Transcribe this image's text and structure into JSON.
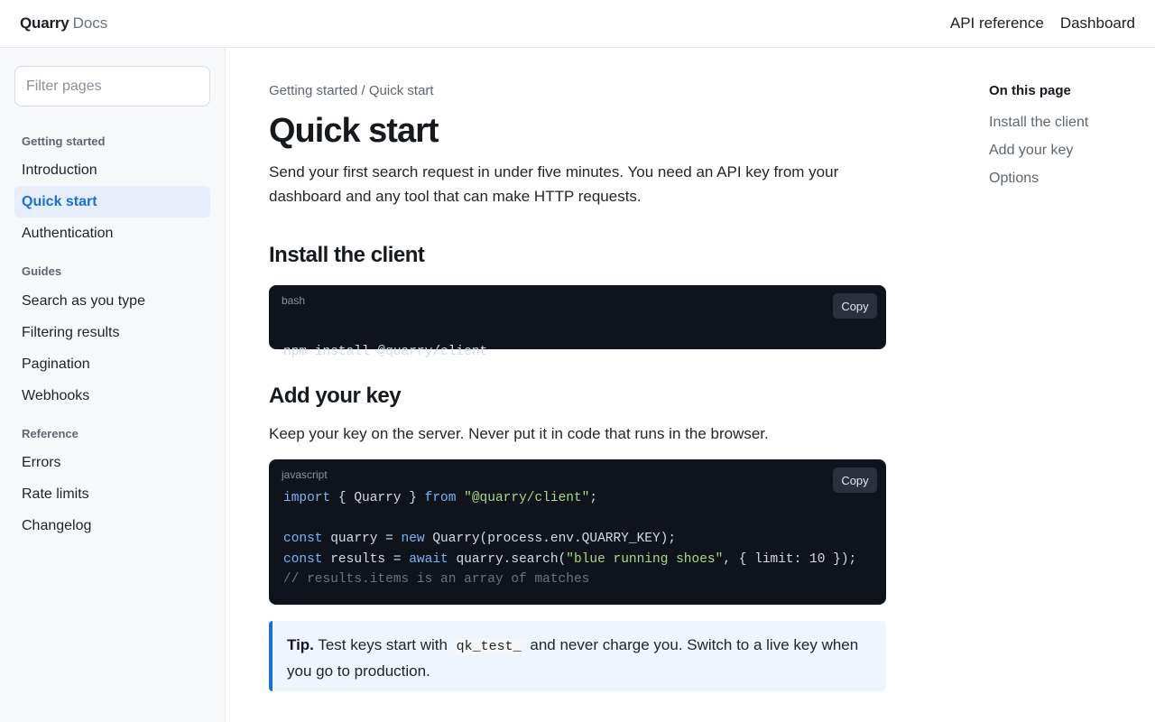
{
  "header": {
    "brand_name": "Quarry",
    "brand_suffix": "Docs",
    "nav": [
      "API reference",
      "Dashboard"
    ]
  },
  "sidebar": {
    "filter_placeholder": "Filter pages",
    "sections": [
      {
        "title": "Getting started",
        "items": [
          "Introduction",
          "Quick start",
          "Authentication"
        ]
      },
      {
        "title": "Guides",
        "items": [
          "Search as you type",
          "Filtering results",
          "Pagination",
          "Webhooks"
        ]
      },
      {
        "title": "Reference",
        "items": [
          "Errors",
          "Rate limits",
          "Changelog"
        ]
      }
    ],
    "active_item": "Quick start"
  },
  "main": {
    "breadcrumb": "Getting started / Quick start",
    "title": "Quick start",
    "intro": "Send your first search request in under five minutes. You need an API key from your dashboard and any tool that can make HTTP requests.",
    "install": {
      "heading": "Install the client",
      "code_lang": "bash",
      "copy_label": "Copy",
      "code": "npm install @quarry/client"
    },
    "key": {
      "heading": "Add your key",
      "text": "Keep your key on the server. Never put it in code that runs in the browser.",
      "code_lang": "javascript",
      "copy_label": "Copy",
      "code_lines": [
        [
          {
            "t": "import",
            "c": "kw"
          },
          {
            "t": " { Quarry } "
          },
          {
            "t": "from",
            "c": "kw"
          },
          {
            "t": " "
          },
          {
            "t": "\"@quarry/client\"",
            "c": "str"
          },
          {
            "t": ";"
          }
        ],
        [],
        [
          {
            "t": "const",
            "c": "kw"
          },
          {
            "t": " quarry = "
          },
          {
            "t": "new",
            "c": "kw"
          },
          {
            "t": " Quarry(process.env.QUARRY_KEY);"
          }
        ],
        [
          {
            "t": "const",
            "c": "kw"
          },
          {
            "t": " results = "
          },
          {
            "t": "await",
            "c": "kw"
          },
          {
            "t": " quarry.search("
          },
          {
            "t": "\"blue running shoes\"",
            "c": "str"
          },
          {
            "t": ", { limit: 10 });"
          }
        ],
        [
          {
            "t": "// results.items is an array of matches",
            "c": "cm"
          }
        ]
      ]
    },
    "tip": {
      "label": "Tip.",
      "before": " Test keys start with ",
      "code": "qk_test_",
      "after": " and never charge you. Switch to a live key when you go to production."
    }
  },
  "toc": {
    "title": "On this page",
    "items": [
      "Install the client",
      "Add your key",
      "Options"
    ]
  }
}
